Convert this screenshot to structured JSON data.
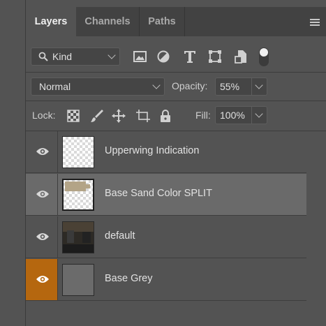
{
  "tabs": [
    {
      "label": "Layers",
      "active": true
    },
    {
      "label": "Channels",
      "active": false
    },
    {
      "label": "Paths",
      "active": false
    }
  ],
  "filter": {
    "kind_label": "Kind",
    "icons": [
      "image-filter-icon",
      "adjustment-filter-icon",
      "type-filter-icon",
      "shape-filter-icon",
      "smart-object-filter-icon",
      "filter-toggle-icon"
    ]
  },
  "blend": {
    "mode": "Normal",
    "opacity_label": "Opacity:",
    "opacity_value": "55%"
  },
  "lock": {
    "label": "Lock:",
    "fill_label": "Fill:",
    "fill_value": "100%"
  },
  "layers": [
    {
      "name": "Upperwing Indication",
      "visible": true,
      "selected": false
    },
    {
      "name": "Base Sand Color SPLIT",
      "visible": true,
      "selected": true
    },
    {
      "name": "default",
      "visible": true,
      "selected": false
    },
    {
      "name": "Base Grey",
      "visible": true,
      "selected": false,
      "eye_highlight": "#b5670f"
    }
  ],
  "colors": {
    "panel_bg": "#535353",
    "selected_row": "#6a6a6a",
    "highlight_orange": "#b5670f",
    "sand": "#b3a487",
    "grey_layer": "#6b6b6b"
  }
}
